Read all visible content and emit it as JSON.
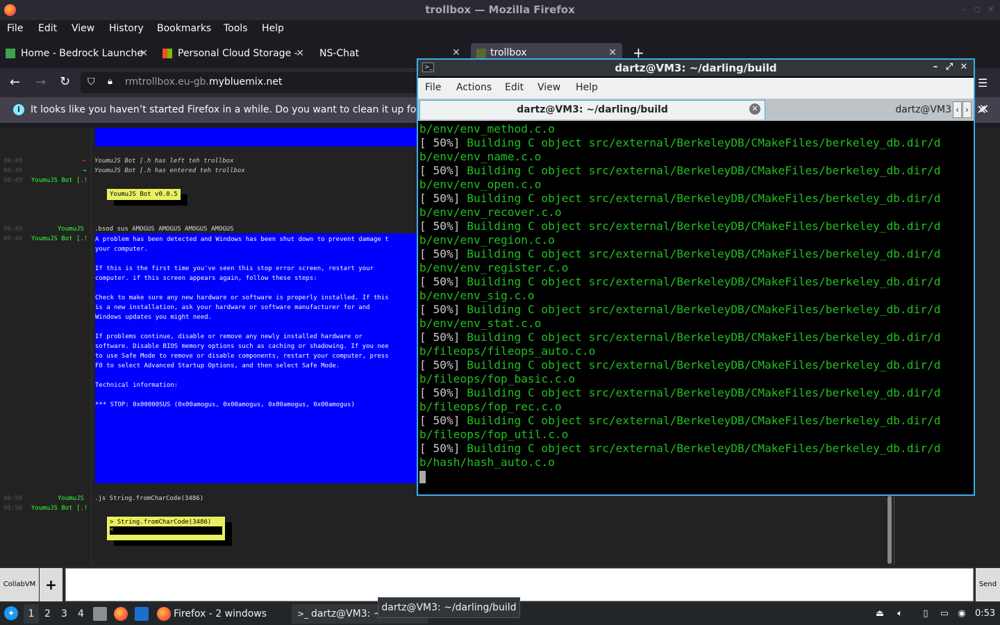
{
  "firefox": {
    "window_title": "trollbox — Mozilla Firefox",
    "menu": [
      "File",
      "Edit",
      "View",
      "History",
      "Bookmarks",
      "Tools",
      "Help"
    ],
    "tabs": [
      {
        "label": "Home - Bedrock Launche"
      },
      {
        "label": "Personal Cloud Storage -"
      },
      {
        "label": "NS-Chat"
      },
      {
        "label": "trollbox"
      }
    ],
    "url_prefix": "rmtrollbox.eu-gb.",
    "url_domain": "mybluemix.net",
    "notice": "It looks like you haven’t started Firefox in a while. Do you want to clean it up for a f"
  },
  "trollbox": {
    "lines": [
      {
        "time": "00:49",
        "arrow": "←",
        "text": "YoumuJS Bot [.h has left teh trollbox"
      },
      {
        "time": "00:49",
        "arrow": "→",
        "text": "YoumuJS Bot [.h has entered teh trollbox"
      },
      {
        "time": "00:49",
        "nick": "YoumuJS Bot [.!"
      },
      {
        "time": "00:49",
        "nick": "YoumuJS",
        "text": ".bsod sus AMOGUS AMOGUS AMOGUS AMOGUS"
      },
      {
        "time": "00:49",
        "nick": "YoumuJS Bot [.!"
      },
      {
        "time": "00:50",
        "nick": "YoumuJS",
        "text": ".js String.fromCharCode(3486)"
      },
      {
        "time": "00:50",
        "nick": "YoumuJS Bot [.!"
      }
    ],
    "bot_version": "YoumuJS Bot v0.0.5",
    "bsod_text": "A problem has been detected and Windows has been shut down to prevent damage t\nyour computer.\n\nIf this is the first time you've seen this stop error screen, restart your\ncomputer. if this screen appears again, follow these steps:\n\nCheck to make sure any new hardware or software is properly installed. If this\nis a new installation, ask your hardware or software manufacturer for and\nWindows updates you might need.\n\nIf problems continue, disable or remove any newly installed hardware or\nsoftware. Disable BIOS memory options such as caching or shadowing. If you nee\nto use Safe Mode to remove or disable components, restart your computer, press\nF8 to select Advanced Startup Options, and then select Safe Mode.\n\nTechnical information:\n\n*** STOP: 0x00000SUS (0x00amogus, 0x00amogus, 0x00amogus, 0x00amogus)",
    "js_result_line1": "> String.fromCharCode(3486)",
    "js_result_line2": "<",
    "collab_label": "CollabVM",
    "plus_label": "+",
    "send_label": "Send"
  },
  "terminal": {
    "title": "dartz@VM3: ~/darling/build",
    "menu": [
      "File",
      "Actions",
      "Edit",
      "View",
      "Help"
    ],
    "tab_active": "dartz@VM3: ~/darling/build",
    "tab_second": "dartz@VM3",
    "first_line": "b/env/env_method.c.o",
    "build_lines": [
      {
        "pct": "[ 50%]",
        "msg": "Building C object src/external/BerkeleyDB/CMakeFiles/berkeley_db.dir/d",
        "cont": "b/env/env_name.c.o"
      },
      {
        "pct": "[ 50%]",
        "msg": "Building C object src/external/BerkeleyDB/CMakeFiles/berkeley_db.dir/d",
        "cont": "b/env/env_open.c.o"
      },
      {
        "pct": "[ 50%]",
        "msg": "Building C object src/external/BerkeleyDB/CMakeFiles/berkeley_db.dir/d",
        "cont": "b/env/env_recover.c.o"
      },
      {
        "pct": "[ 50%]",
        "msg": "Building C object src/external/BerkeleyDB/CMakeFiles/berkeley_db.dir/d",
        "cont": "b/env/env_region.c.o"
      },
      {
        "pct": "[ 50%]",
        "msg": "Building C object src/external/BerkeleyDB/CMakeFiles/berkeley_db.dir/d",
        "cont": "b/env/env_register.c.o"
      },
      {
        "pct": "[ 50%]",
        "msg": "Building C object src/external/BerkeleyDB/CMakeFiles/berkeley_db.dir/d",
        "cont": "b/env/env_sig.c.o"
      },
      {
        "pct": "[ 50%]",
        "msg": "Building C object src/external/BerkeleyDB/CMakeFiles/berkeley_db.dir/d",
        "cont": "b/env/env_stat.c.o"
      },
      {
        "pct": "[ 50%]",
        "msg": "Building C object src/external/BerkeleyDB/CMakeFiles/berkeley_db.dir/d",
        "cont": "b/fileops/fileops_auto.c.o"
      },
      {
        "pct": "[ 50%]",
        "msg": "Building C object src/external/BerkeleyDB/CMakeFiles/berkeley_db.dir/d",
        "cont": "b/fileops/fop_basic.c.o"
      },
      {
        "pct": "[ 50%]",
        "msg": "Building C object src/external/BerkeleyDB/CMakeFiles/berkeley_db.dir/d",
        "cont": "b/fileops/fop_rec.c.o"
      },
      {
        "pct": "[ 50%]",
        "msg": "Building C object src/external/BerkeleyDB/CMakeFiles/berkeley_db.dir/d",
        "cont": "b/fileops/fop_util.c.o"
      },
      {
        "pct": "[ 50%]",
        "msg": "Building C object src/external/BerkeleyDB/CMakeFiles/berkeley_db.dir/d",
        "cont": "b/hash/hash_auto.c.o"
      }
    ]
  },
  "taskbar": {
    "workspaces": [
      "1",
      "2",
      "3",
      "4"
    ],
    "firefox_task": "Firefox - 2 windows",
    "terminal_task": "dartz@VM3: ~",
    "tooltip": "dartz@VM3: ~/darling/build",
    "clock": "0:53"
  },
  "colors": {
    "terminal_green": "#20c020",
    "bsod_blue": "#0000ff",
    "kde_accent": "#3daee9"
  }
}
